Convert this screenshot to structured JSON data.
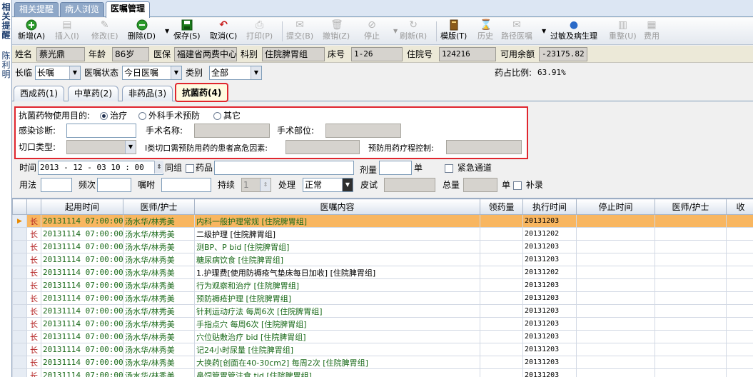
{
  "left_strip": {
    "top_text": [
      "相",
      "关",
      "提",
      "醒"
    ],
    "bottom_text": [
      "陈",
      "利",
      "明"
    ]
  },
  "top_tabs": [
    {
      "label": "相关提醒",
      "active": false
    },
    {
      "label": "病人浏览",
      "active": false
    },
    {
      "label": "医嘱管理",
      "active": true
    }
  ],
  "toolbar": [
    {
      "name": "new",
      "label": "新增(A)",
      "icon": "plus-circle-icon",
      "enabled": true
    },
    {
      "name": "insert",
      "label": "插入(I)",
      "icon": "insert-icon",
      "enabled": false
    },
    {
      "name": "modify",
      "label": "修改(E)",
      "icon": "edit-icon",
      "enabled": false
    },
    {
      "name": "delete",
      "label": "删除(D)",
      "icon": "minus-circle-icon",
      "enabled": true
    },
    {
      "name": "save",
      "label": "保存(S)",
      "icon": "save-icon",
      "enabled": true
    },
    {
      "name": "cancel",
      "label": "取消(C)",
      "icon": "undo-icon",
      "enabled": true
    },
    {
      "name": "print",
      "label": "打印(P)",
      "icon": "print-icon",
      "enabled": false
    },
    {
      "name": "submit",
      "label": "提交(B)",
      "icon": "submit-icon",
      "enabled": false
    },
    {
      "name": "revoke",
      "label": "撤销(Z)",
      "icon": "trash-icon",
      "enabled": false
    },
    {
      "name": "stop",
      "label": "停止",
      "icon": "stop-icon",
      "enabled": false
    },
    {
      "name": "refresh",
      "label": "刷新(R)",
      "icon": "refresh-icon",
      "enabled": false
    },
    {
      "name": "template",
      "label": "模版(T)",
      "icon": "book-icon",
      "enabled": true
    },
    {
      "name": "history",
      "label": "历史",
      "icon": "history-icon",
      "enabled": false
    },
    {
      "name": "pathway",
      "label": "路径医嘱",
      "icon": "pathway-icon",
      "enabled": false
    },
    {
      "name": "allergy",
      "label": "过敏及病生理",
      "icon": "allergy-icon",
      "enabled": true
    },
    {
      "name": "reorganize",
      "label": "重整(U)",
      "icon": "reorganize-icon",
      "enabled": false
    },
    {
      "name": "fee",
      "label": "费用",
      "icon": "fee-icon",
      "enabled": false
    }
  ],
  "patient": {
    "name_label": "姓名",
    "name": "蔡光鼎",
    "age_label": "年龄",
    "age": "86岁",
    "insurance_label": "医保",
    "insurance": "福建省两费中心",
    "dept_label": "科别",
    "dept": "住院脾胃组",
    "bed_label": "床号",
    "bed": "1-26",
    "inpatient_no_label": "住院号",
    "inpatient_no": "124216",
    "balance_label": "可用余额",
    "balance": "-23175.82"
  },
  "filters": {
    "longterm_label": "长临",
    "longterm_value": "长嘱",
    "status_label": "医嘱状态",
    "status_value": "今日医嘱",
    "category_label": "类别",
    "category_value": "全部",
    "drug_ratio_label": "药占比例:",
    "drug_ratio_value": "63.91%"
  },
  "med_tabs": [
    {
      "label": "西成药(1)",
      "active": false
    },
    {
      "label": "中草药(2)",
      "active": false
    },
    {
      "label": "非药品(3)",
      "active": false
    },
    {
      "label": "抗菌药(4)",
      "active": true
    }
  ],
  "antibiotic": {
    "purpose_label": "抗菌药物使用目的:",
    "purpose_options": [
      {
        "label": "治疗",
        "checked": true
      },
      {
        "label": "外科手术预防",
        "checked": false
      },
      {
        "label": "其它",
        "checked": false
      }
    ],
    "infection_label": "感染诊断:",
    "surgery_name_label": "手术名称:",
    "surgery_site_label": "手术部位:",
    "incision_label": "切口类型:",
    "risk_label": "I类切口需预防用药的患者高危因素:",
    "course_label": "预防用药疗程控制:"
  },
  "entry": {
    "time_label": "时间",
    "time_value": "2013 - 12 - 03    10 : 00",
    "group_label": "同组",
    "drug_label": "药品",
    "dose_label": "剂量",
    "unit_label": "单",
    "emergency_label": "紧急通道",
    "usage_label": "用法",
    "freq_label": "频次",
    "instruction_label": "嘱咐",
    "duration_label": "持续",
    "duration_value": "1",
    "handle_label": "处理",
    "handle_value": "正常",
    "skin_label": "皮试",
    "total_label": "总量",
    "unit2_label": "单",
    "supplement_label": "补录"
  },
  "table": {
    "columns": [
      "",
      "",
      "起用时间",
      "医师/护士",
      "医嘱内容",
      "领药量",
      "执行时间",
      "停止时间",
      "医师/护士",
      "收"
    ],
    "rows": [
      {
        "type": "长",
        "start": "20131114 07:00:00",
        "doctor": "汤水华/林秀美",
        "content": "内科一般护理常规    [住院脾胃组]",
        "exec": "20131203",
        "selected": true,
        "black": false
      },
      {
        "type": "长",
        "start": "20131114 07:00:00",
        "doctor": "汤水华/林秀美",
        "content": "二级护理    [住院脾胃组]",
        "exec": "20131202",
        "selected": false,
        "black": true
      },
      {
        "type": "长",
        "start": "20131114 07:00:00",
        "doctor": "汤水华/林秀美",
        "content": "测BP、P bid    [住院脾胃组]",
        "exec": "20131203",
        "selected": false,
        "black": false
      },
      {
        "type": "长",
        "start": "20131114 07:00:00",
        "doctor": "汤水华/林秀美",
        "content": "糖尿病饮食    [住院脾胃组]",
        "exec": "20131203",
        "selected": false,
        "black": false
      },
      {
        "type": "长",
        "start": "20131114 07:00:00",
        "doctor": "汤水华/林秀美",
        "content": "1.护理费[使用防褥疮气垫床每日加收]    [住院脾胃组]",
        "exec": "20131202",
        "selected": false,
        "black": true
      },
      {
        "type": "长",
        "start": "20131114 07:00:00",
        "doctor": "汤水华/林秀美",
        "content": "行为观察和治疗    [住院脾胃组]",
        "exec": "20131203",
        "selected": false,
        "black": false
      },
      {
        "type": "长",
        "start": "20131114 07:00:00",
        "doctor": "汤水华/林秀美",
        "content": "预防褥疮护理    [住院脾胃组]",
        "exec": "20131203",
        "selected": false,
        "black": false
      },
      {
        "type": "长",
        "start": "20131114 07:00:00",
        "doctor": "汤水华/林秀美",
        "content": "针刺运动疗法 每周6次    [住院脾胃组]",
        "exec": "20131203",
        "selected": false,
        "black": false
      },
      {
        "type": "长",
        "start": "20131114 07:00:00",
        "doctor": "汤水华/林秀美",
        "content": "手指点穴 每周6次    [住院脾胃组]",
        "exec": "20131203",
        "selected": false,
        "black": false
      },
      {
        "type": "长",
        "start": "20131114 07:00:00",
        "doctor": "汤水华/林秀美",
        "content": "穴位贴敷治疗 bid    [住院脾胃组]",
        "exec": "20131203",
        "selected": false,
        "black": false
      },
      {
        "type": "长",
        "start": "20131114 07:00:00",
        "doctor": "汤水华/林秀美",
        "content": "记24小时尿量    [住院脾胃组]",
        "exec": "20131203",
        "selected": false,
        "black": false
      },
      {
        "type": "长",
        "start": "20131114 07:00:00",
        "doctor": "汤水华/林秀美",
        "content": "大换药[创面在40-30cm2] 每周2次    [住院脾胃组]",
        "exec": "20131203",
        "selected": false,
        "black": false
      },
      {
        "type": "长",
        "start": "20131114 07:00:00",
        "doctor": "汤水华/林秀美",
        "content": "鼻饲管胃管注食 tid    [住院脾胃组]",
        "exec": "20131203",
        "selected": false,
        "black": false
      }
    ]
  },
  "colors": {
    "highlight_red": "#e0262e",
    "selected_row": "#f8b660",
    "text_green": "#1a6a1a"
  }
}
